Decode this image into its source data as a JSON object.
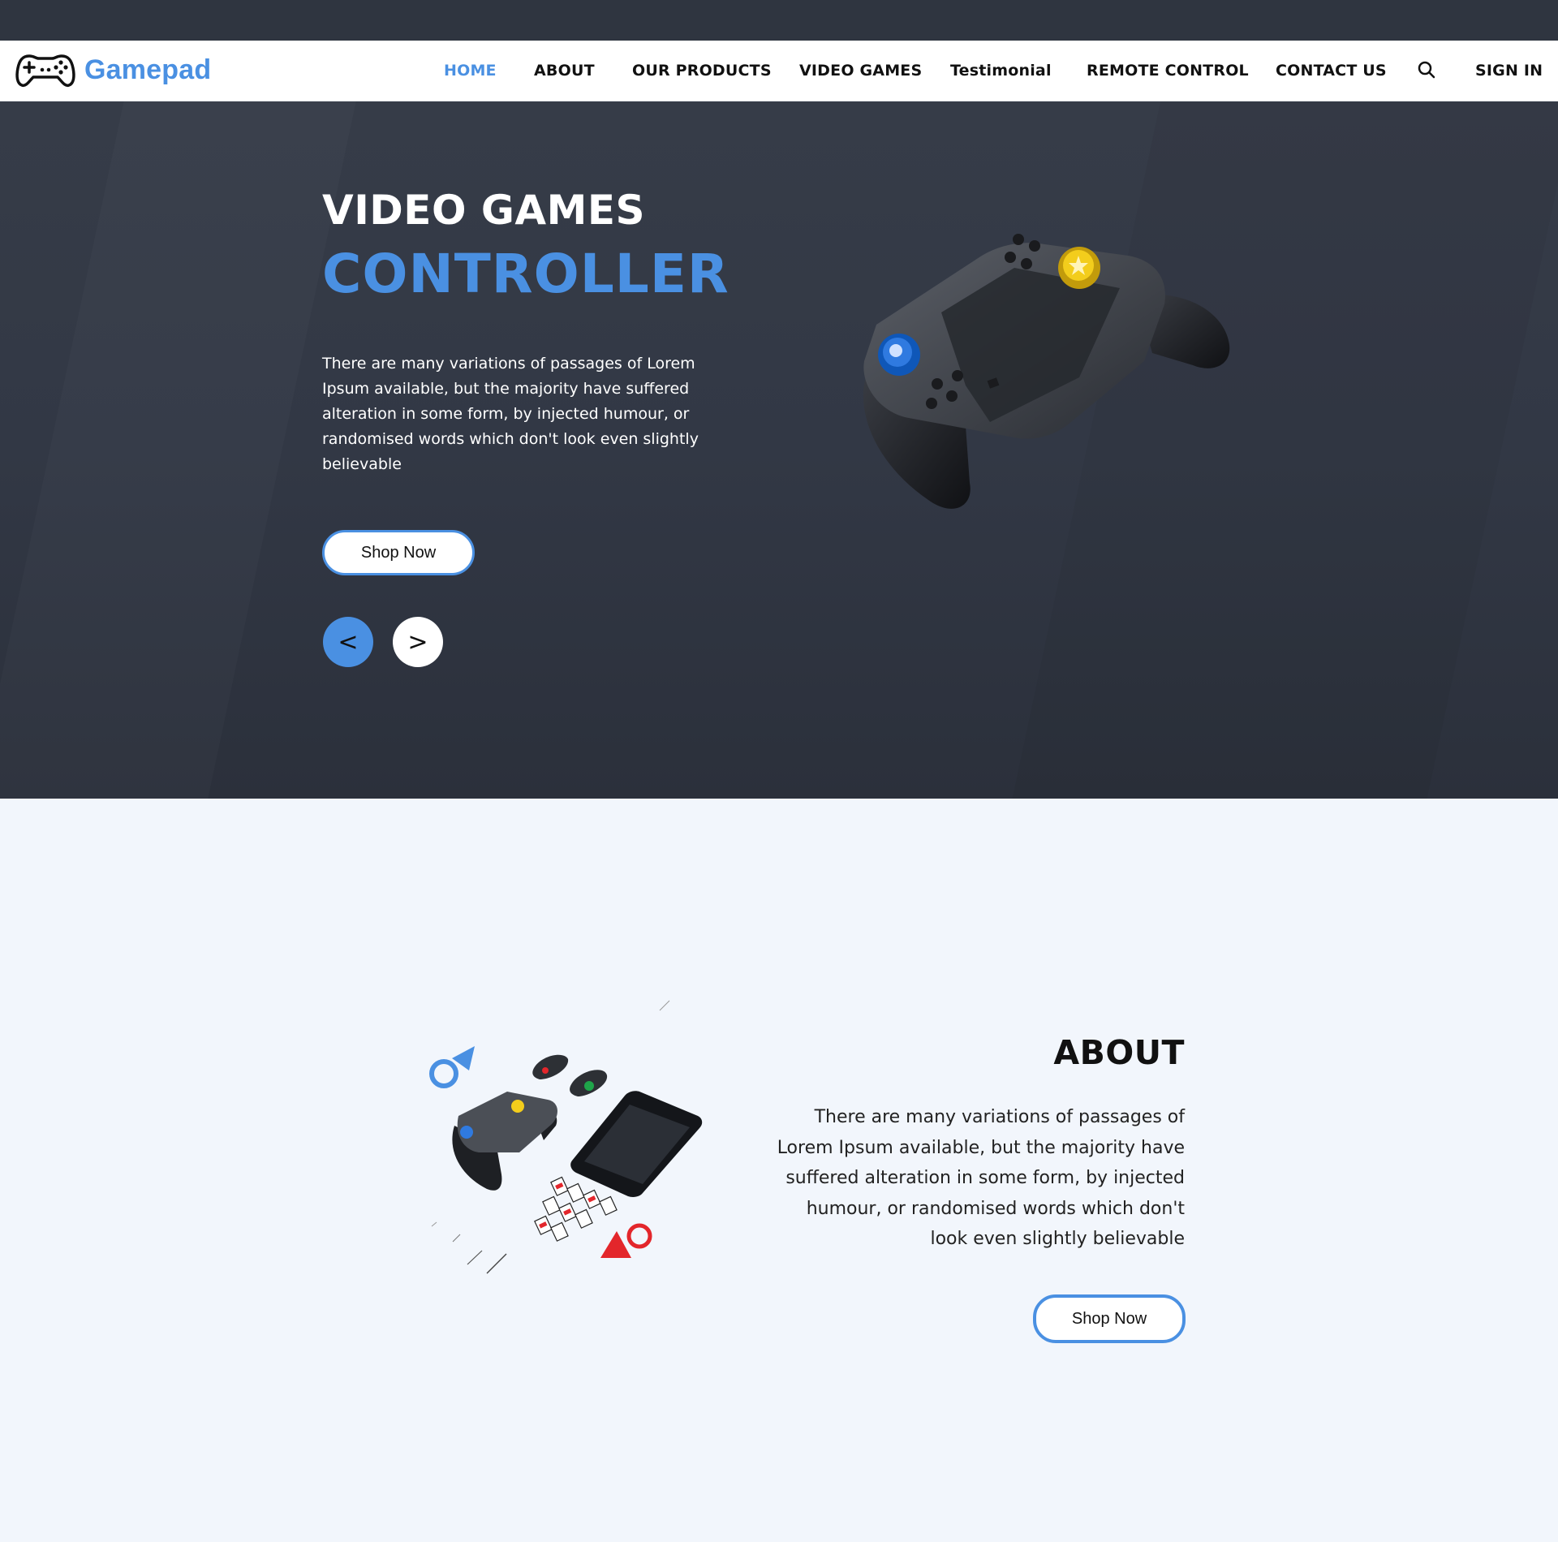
{
  "brand": {
    "name": "Gamepad"
  },
  "nav": {
    "items": [
      {
        "label": "HOME",
        "active": true
      },
      {
        "label": "ABOUT",
        "active": false
      },
      {
        "label": "OUR PRODUCTS",
        "active": false
      },
      {
        "label": "VIDEO GAMES",
        "active": false
      },
      {
        "label": "Testimonial",
        "active": false
      },
      {
        "label": "REMOTE CONTROL",
        "active": false
      },
      {
        "label": "CONTACT US",
        "active": false
      }
    ],
    "search_icon": "search-icon",
    "sign_in": "SIGN IN"
  },
  "hero": {
    "title_line1": "VIDEO GAMES",
    "title_line2": "CONTROLLER",
    "text": "There are many variations of passages of Lorem Ipsum available, but the majority have suffered alteration in some form, by injected humour, or randomised words which don't look even slightly believable",
    "button": "Shop Now",
    "prev": "<",
    "next": ">"
  },
  "about": {
    "title": "ABOUT",
    "text": "There are many variations of passages of Lorem Ipsum available, but the majority have suffered alteration in some form, by injected humour, or randomised words which don't look even slightly believable",
    "button": "Shop Now"
  },
  "colors": {
    "accent": "#4a90e2",
    "dark_bg": "#323845",
    "light_bg": "#f2f6fc",
    "accent_red": "#e3262b"
  }
}
